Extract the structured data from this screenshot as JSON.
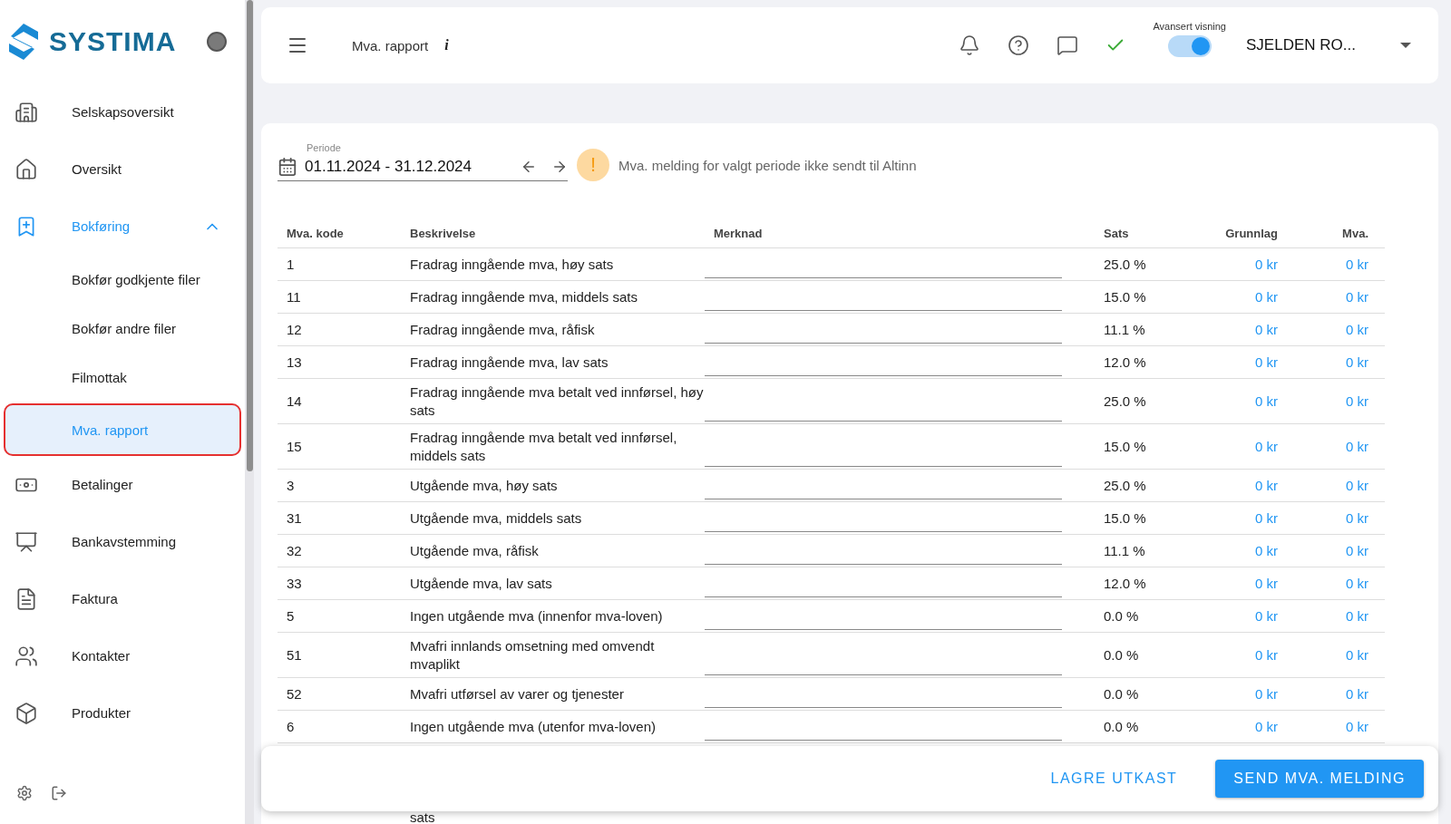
{
  "sidebar": {
    "logo": "SYSTIMA",
    "items": [
      {
        "label": "Selskapsoversikt",
        "kind": "nav",
        "selected": false
      },
      {
        "label": "Oversikt",
        "kind": "nav",
        "selected": false
      },
      {
        "label": "Bokføring",
        "kind": "group",
        "selected": true,
        "expanded": true,
        "children": [
          {
            "label": "Bokfør godkjente filer",
            "selected": false
          },
          {
            "label": "Bokfør andre filer",
            "selected": false
          },
          {
            "label": "Filmottak",
            "selected": false
          },
          {
            "label": "Mva. rapport",
            "selected": true
          }
        ]
      },
      {
        "label": "Betalinger",
        "kind": "nav",
        "selected": false
      },
      {
        "label": "Bankavstemming",
        "kind": "nav",
        "selected": false
      },
      {
        "label": "Faktura",
        "kind": "nav",
        "selected": false
      },
      {
        "label": "Kontakter",
        "kind": "nav",
        "selected": false
      },
      {
        "label": "Produkter",
        "kind": "nav",
        "selected": false
      }
    ]
  },
  "header": {
    "title": "Mva. rapport",
    "info": "i",
    "toggle_label": "Avansert visning",
    "advanced_view": true,
    "company": "SJELDEN RO..."
  },
  "period": {
    "label": "Periode",
    "value": "01.11.2024 - 31.12.2024",
    "warning_mark": "!",
    "warning": "Mva. melding for valgt periode ikke sendt til Altinn"
  },
  "table": {
    "columns": [
      "Mva. kode",
      "Beskrivelse",
      "Merknad",
      "Sats",
      "Grunnlag",
      "Mva."
    ],
    "rows": [
      {
        "code": "1",
        "description": "Fradrag inngående mva, høy sats",
        "rate": "25.0 %",
        "basis": "0 kr",
        "vat": "0 kr"
      },
      {
        "code": "11",
        "description": "Fradrag inngående mva, middels sats",
        "rate": "15.0 %",
        "basis": "0 kr",
        "vat": "0 kr"
      },
      {
        "code": "12",
        "description": "Fradrag inngående mva, råfisk",
        "rate": "11.1 %",
        "basis": "0 kr",
        "vat": "0 kr"
      },
      {
        "code": "13",
        "description": "Fradrag inngående mva, lav sats",
        "rate": "12.0 %",
        "basis": "0 kr",
        "vat": "0 kr"
      },
      {
        "code": "14",
        "description": "Fradrag inngående mva betalt ved innførsel, høy sats",
        "rate": "25.0 %",
        "basis": "0 kr",
        "vat": "0 kr"
      },
      {
        "code": "15",
        "description": "Fradrag inngående mva betalt ved innførsel, middels sats",
        "rate": "15.0 %",
        "basis": "0 kr",
        "vat": "0 kr"
      },
      {
        "code": "3",
        "description": "Utgående mva, høy sats",
        "rate": "25.0 %",
        "basis": "0 kr",
        "vat": "0 kr"
      },
      {
        "code": "31",
        "description": "Utgående mva, middels sats",
        "rate": "15.0 %",
        "basis": "0 kr",
        "vat": "0 kr"
      },
      {
        "code": "32",
        "description": "Utgående mva, råfisk",
        "rate": "11.1 %",
        "basis": "0 kr",
        "vat": "0 kr"
      },
      {
        "code": "33",
        "description": "Utgående mva, lav sats",
        "rate": "12.0 %",
        "basis": "0 kr",
        "vat": "0 kr"
      },
      {
        "code": "5",
        "description": "Ingen utgående mva (innenfor mva-loven)",
        "rate": "0.0 %",
        "basis": "0 kr",
        "vat": "0 kr"
      },
      {
        "code": "51",
        "description": "Mvafri innlands omsetning med omvendt mvaplikt",
        "rate": "0.0 %",
        "basis": "0 kr",
        "vat": "0 kr"
      },
      {
        "code": "52",
        "description": "Mvafri utførsel av varer og tjenester",
        "rate": "0.0 %",
        "basis": "0 kr",
        "vat": "0 kr"
      },
      {
        "code": "6",
        "description": "Ingen utgående mva (utenfor mva-loven)",
        "rate": "0.0 %",
        "basis": "0 kr",
        "vat": "0 kr"
      },
      {
        "kind": "partial",
        "description": "sats"
      }
    ]
  },
  "footer": {
    "buttons": [
      {
        "label": "LAGRE UTKAST",
        "kind": "text"
      },
      {
        "label": "SEND MVA. MELDING",
        "kind": "primary"
      }
    ]
  }
}
